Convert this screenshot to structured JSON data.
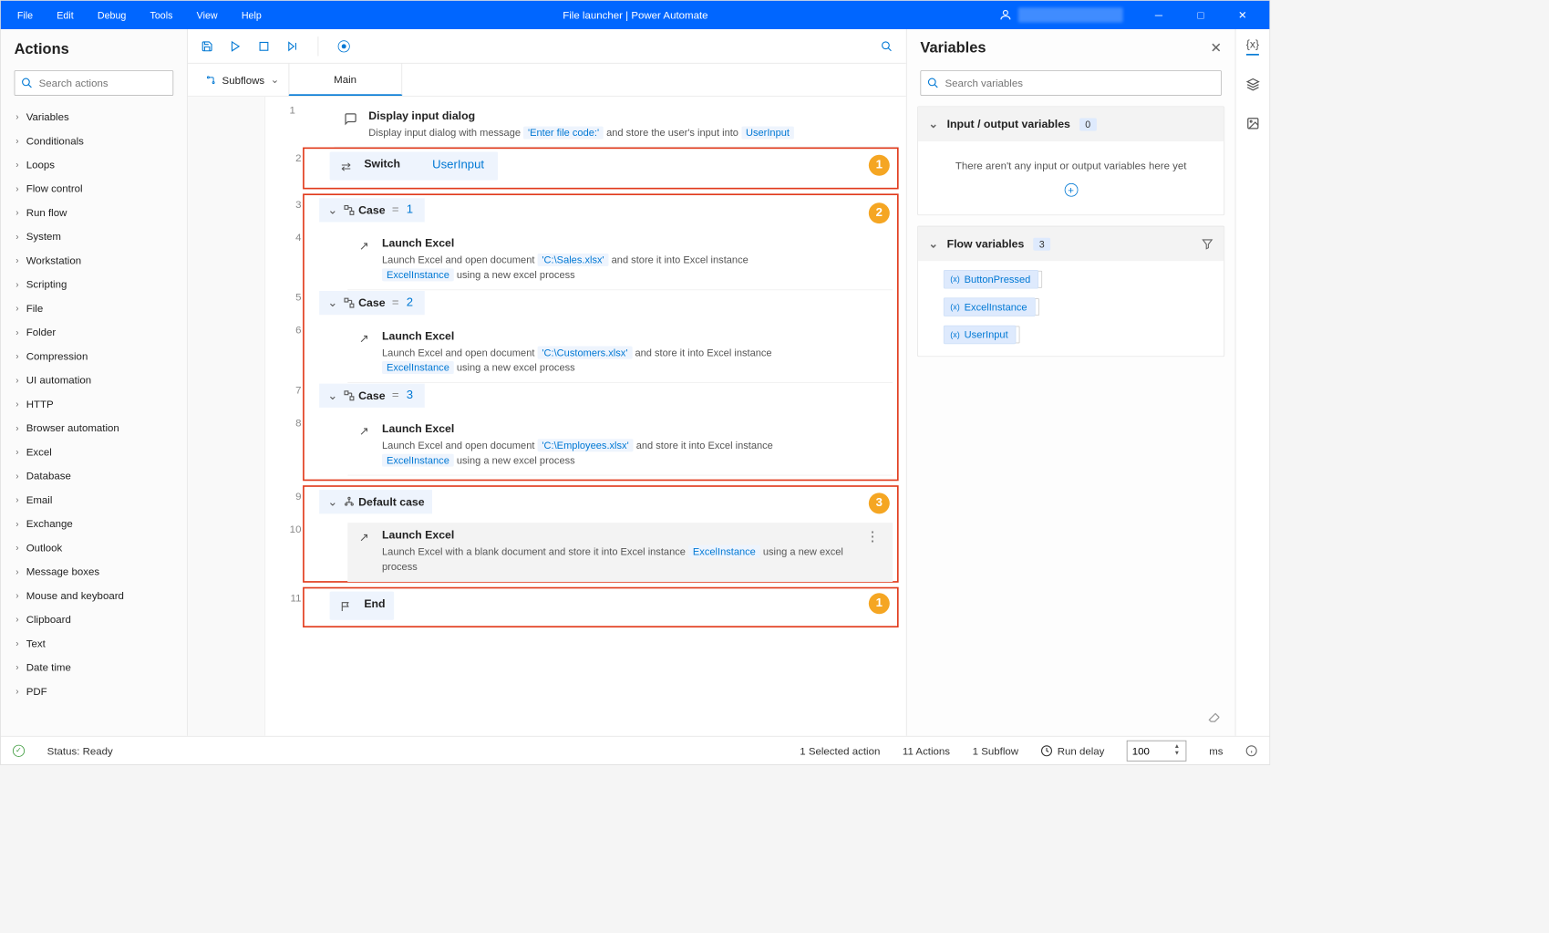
{
  "titlebar": {
    "menus": [
      "File",
      "Edit",
      "Debug",
      "Tools",
      "View",
      "Help"
    ],
    "title": "File launcher | Power Automate"
  },
  "actions": {
    "title": "Actions",
    "search_placeholder": "Search actions",
    "items": [
      "Variables",
      "Conditionals",
      "Loops",
      "Flow control",
      "Run flow",
      "System",
      "Workstation",
      "Scripting",
      "File",
      "Folder",
      "Compression",
      "UI automation",
      "HTTP",
      "Browser automation",
      "Excel",
      "Database",
      "Email",
      "Exchange",
      "Outlook",
      "Message boxes",
      "Mouse and keyboard",
      "Clipboard",
      "Text",
      "Date time",
      "PDF"
    ]
  },
  "tabs": {
    "subflows": "Subflows",
    "main": "Main"
  },
  "steps": {
    "s1": {
      "title": "Display input dialog",
      "desc_a": "Display input dialog with message ",
      "desc_str": "'Enter file code:'",
      "desc_b": " and store the user's input into ",
      "var": "UserInput"
    },
    "s2": {
      "title": "Switch",
      "var": "UserInput"
    },
    "s3": {
      "title": "Case",
      "eq": "=",
      "val": "1"
    },
    "s4": {
      "title": "Launch Excel",
      "desc_a": "Launch Excel and open document ",
      "path": "'C:\\Sales.xlsx'",
      "desc_b": " and store it into Excel instance ",
      "var": "ExcelInstance",
      "desc_c": " using a new excel process"
    },
    "s5": {
      "title": "Case",
      "eq": "=",
      "val": "2"
    },
    "s6": {
      "title": "Launch Excel",
      "desc_a": "Launch Excel and open document ",
      "path": "'C:\\Customers.xlsx'",
      "desc_b": " and store it into Excel instance ",
      "var": "ExcelInstance",
      "desc_c": " using a new excel process"
    },
    "s7": {
      "title": "Case",
      "eq": "=",
      "val": "3"
    },
    "s8": {
      "title": "Launch Excel",
      "desc_a": "Launch Excel and open document ",
      "path": "'C:\\Employees.xlsx'",
      "desc_b": " and store it into Excel instance ",
      "var": "ExcelInstance",
      "desc_c": " using a new excel process"
    },
    "s9": {
      "title": "Default case"
    },
    "s10": {
      "title": "Launch Excel",
      "desc_a": "Launch Excel with a blank document and store it into Excel instance ",
      "var": "ExcelInstance",
      "desc_b": " using a new excel process"
    },
    "s11": {
      "title": "End"
    }
  },
  "variables": {
    "title": "Variables",
    "search_placeholder": "Search variables",
    "io_header": "Input / output variables",
    "io_count": "0",
    "io_empty": "There aren't any input or output variables here yet",
    "flow_header": "Flow variables",
    "flow_count": "3",
    "flow_vars": [
      "ButtonPressed",
      "ExcelInstance",
      "UserInput"
    ]
  },
  "statusbar": {
    "status": "Status: Ready",
    "selected": "1 Selected action",
    "actions": "11 Actions",
    "subflow": "1 Subflow",
    "delay_label": "Run delay",
    "delay_value": "100",
    "delay_unit": "ms"
  },
  "annotations": {
    "a1": "1",
    "a2": "2",
    "a3": "3",
    "a4": "1"
  }
}
